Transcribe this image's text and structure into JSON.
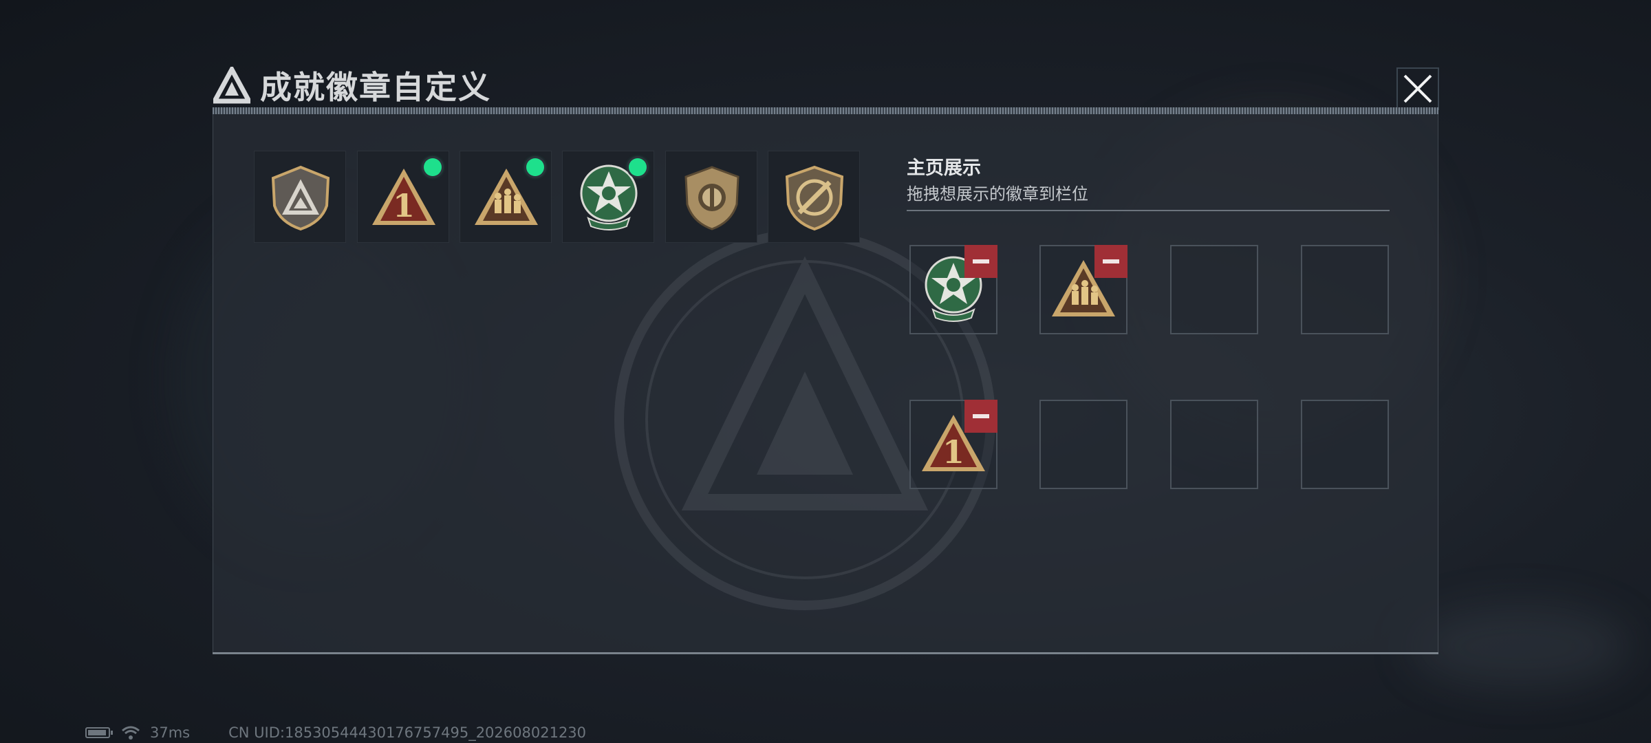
{
  "dialog": {
    "title": "成就徽章自定义"
  },
  "inventory": {
    "badges": [
      {
        "icon": "shield-logo-badge-icon",
        "is_new": false
      },
      {
        "icon": "triangle-number-one-badge-icon",
        "is_new": true
      },
      {
        "icon": "triangle-soldiers-badge-icon",
        "is_new": true
      },
      {
        "icon": "green-star-skull-badge-icon",
        "is_new": true
      },
      {
        "icon": "shield-emblem-badge-icon",
        "is_new": false
      },
      {
        "icon": "shield-knife-badge-icon",
        "is_new": false
      }
    ]
  },
  "showcase": {
    "title": "主页展示",
    "subtitle": "拖拽想展示的徽章到栏位",
    "slots": [
      {
        "badge": "green-star-skull-badge-icon"
      },
      {
        "badge": "triangle-soldiers-badge-icon"
      },
      {
        "badge": null
      },
      {
        "badge": null
      },
      {
        "badge": "triangle-number-one-badge-icon"
      },
      {
        "badge": null
      },
      {
        "badge": null
      },
      {
        "badge": null
      }
    ]
  },
  "status": {
    "ping": "37ms",
    "uid": "CN UID:18530544430176757495_202608021230"
  },
  "colors": {
    "new_indicator": "#1ee08c",
    "remove_button": "#a02f36",
    "badge_gold": "#c9a66b"
  }
}
